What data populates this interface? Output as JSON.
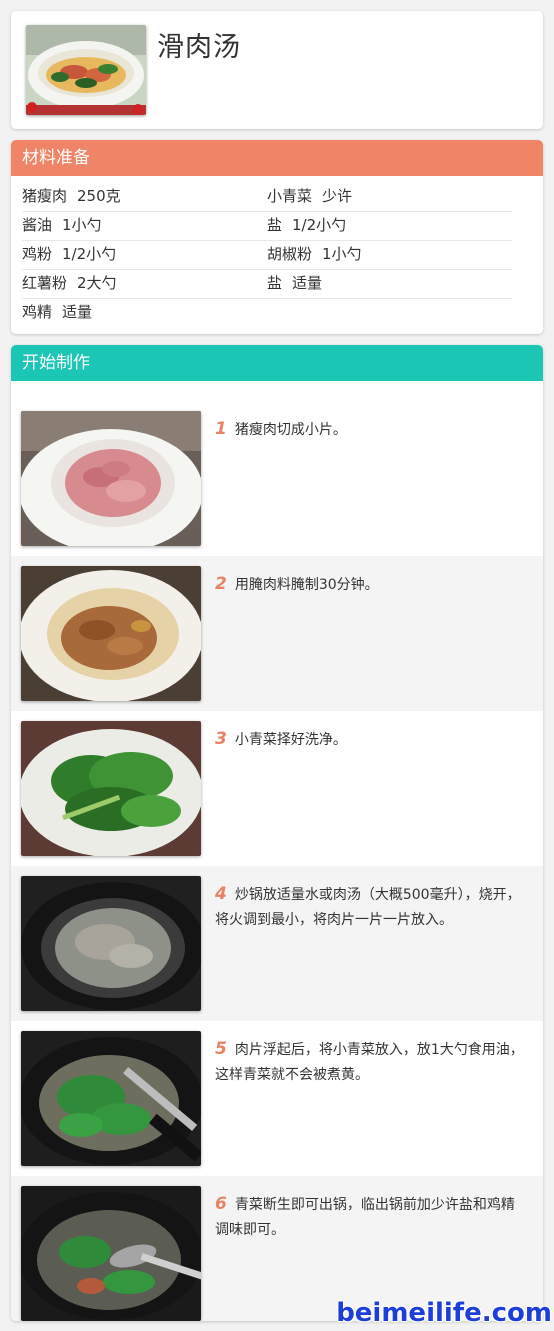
{
  "recipe": {
    "title": "滑肉汤"
  },
  "ingredients": {
    "heading": "材料准备",
    "heading_color": "#ef8466",
    "items": [
      {
        "name": "猪瘦肉",
        "qty": "250克"
      },
      {
        "name": "小青菜",
        "qty": "少许"
      },
      {
        "name": "酱油",
        "qty": "1小勺"
      },
      {
        "name": "盐",
        "qty": "1/2小勺"
      },
      {
        "name": "鸡粉",
        "qty": "1/2小勺"
      },
      {
        "name": "胡椒粉",
        "qty": "1小勺"
      },
      {
        "name": "红薯粉",
        "qty": "2大勺"
      },
      {
        "name": "盐",
        "qty": "适量"
      },
      {
        "name": "鸡精",
        "qty": "适量"
      }
    ]
  },
  "steps": {
    "heading": "开始制作",
    "heading_color": "#1cc6b4",
    "items": [
      {
        "num": "1",
        "text": "猪瘦肉切成小片。",
        "photo": "sliced-pork-photo"
      },
      {
        "num": "2",
        "text": "用腌肉料腌制30分钟。",
        "photo": "marinated-pork-photo"
      },
      {
        "num": "3",
        "text": "小青菜择好洗净。",
        "photo": "greens-photo"
      },
      {
        "num": "4",
        "text": "炒锅放适量水或肉汤（大概500毫升），烧开，将火调到最小，将肉片一片一片放入。",
        "photo": "boiling-pot-photo"
      },
      {
        "num": "5",
        "text": "肉片浮起后，将小青菜放入，放1大勺食用油，这样青菜就不会被煮黄。",
        "photo": "greens-in-pot-photo"
      },
      {
        "num": "6",
        "text": "青菜断生即可出锅，临出锅前加少许盐和鸡精调味即可。",
        "photo": "finished-soup-photo"
      }
    ]
  },
  "watermark": "beimeilife.com"
}
